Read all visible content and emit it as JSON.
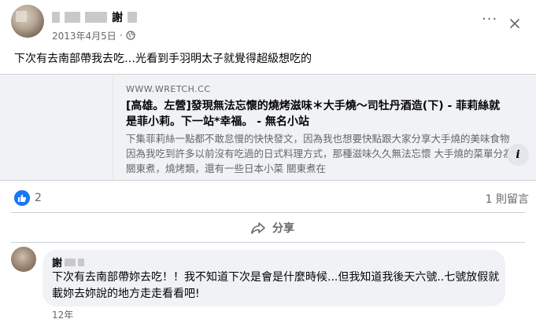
{
  "post": {
    "author_name": "謝",
    "date": "2013年4月5日",
    "separator": "·",
    "visibility_icon": "public-globe-icon",
    "more_icon": "more-horizontal-icon",
    "close_icon": "close-icon",
    "text": "下次有去南部帶我去吃…光看到手羽明太子就覺得超級想吃的"
  },
  "link_preview": {
    "domain": "WWW.WRETCH.CC",
    "title": "[高雄。左營]發現無法忘懷的燒烤滋味＊大手燒～司牡丹酒造(下) - 菲莉絲就是菲小莉。下一站*幸福。 - 無名小站",
    "description": "下集菲莉絲一點都不敢怠慢的快快發文，因為我也想要快點跟大家分享大手燒的美味食物 因為我吃到許多以前沒有吃過的日式料理方式，那種滋味久久無法忘懷 大手燒的菜單分為關東煮，燒烤類，還有一些日本小菜 關東煮在",
    "info_label": "i"
  },
  "stats": {
    "like_count": "2",
    "comment_count": "1 則留言"
  },
  "actions": {
    "share_label": "分享"
  },
  "comment": {
    "author_name": "謝",
    "text": "下次有去南部帶妳去吃！！我不知道下次是會是什麼時候...但我知道我後天六號..七號放假就載妳去妳說的地方走走看看吧!",
    "time": "12年"
  },
  "colors": {
    "accent": "#1877f2",
    "secondary_text": "#65676b",
    "card_background": "#f0f2f5"
  }
}
